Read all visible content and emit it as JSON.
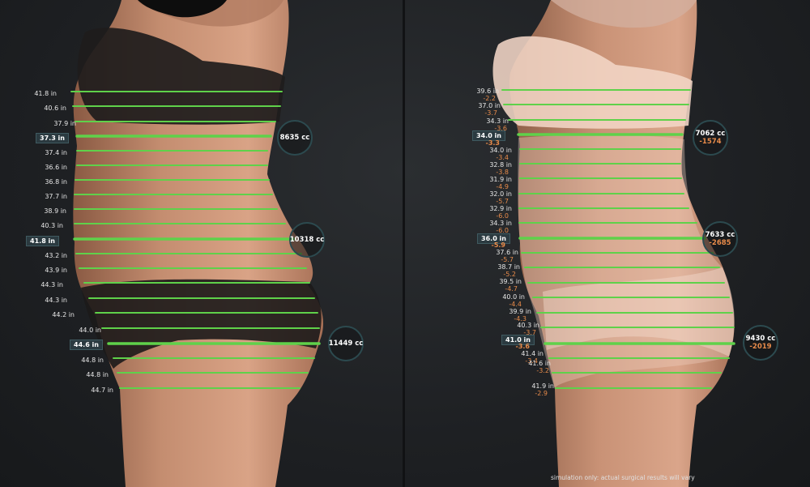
{
  "disclaimer": "simulation only: actual surgical results will vary",
  "colors": {
    "line": "#5fd14a",
    "delta": "#e88b4a",
    "ring": "#2c4a4f"
  },
  "before": {
    "measurements": [
      "41.8 in",
      "40.6 in",
      "37.9 in",
      "37.3 in",
      "37.4 in",
      "36.6 in",
      "36.8 in",
      "37.7 in",
      "38.9 in",
      "40.3 in",
      "41.8 in",
      "43.2 in",
      "43.9 in",
      "44.3 in",
      "44.3 in",
      "44.2 in",
      "44.0 in",
      "44.6 in",
      "44.8 in",
      "44.8 in",
      "44.7 in"
    ],
    "key_indices": [
      3,
      10,
      17
    ],
    "volumes": [
      "8635 cc",
      "10318 cc",
      "11449 cc"
    ]
  },
  "after": {
    "measurements": [
      {
        "value": "39.6 in",
        "delta": "-2.2"
      },
      {
        "value": "37.0 in",
        "delta": "-3.7"
      },
      {
        "value": "34.3 in",
        "delta": "-3.6"
      },
      {
        "value": "34.0 in",
        "delta": "-3.3"
      },
      {
        "value": "34.0 in",
        "delta": "-3.4"
      },
      {
        "value": "32.8 in",
        "delta": "-3.8"
      },
      {
        "value": "31.9 in",
        "delta": "-4.9"
      },
      {
        "value": "32.0 in",
        "delta": "-5.7"
      },
      {
        "value": "32.9 in",
        "delta": "-6.0"
      },
      {
        "value": "34.3 in",
        "delta": "-6.0"
      },
      {
        "value": "36.0 in",
        "delta": "-5.9"
      },
      {
        "value": "37.6 in",
        "delta": "-5.7"
      },
      {
        "value": "38.7 in",
        "delta": "-5.2"
      },
      {
        "value": "39.5 in",
        "delta": "-4.7"
      },
      {
        "value": "40.0 in",
        "delta": "-4.4"
      },
      {
        "value": "39.9 in",
        "delta": "-4.3"
      },
      {
        "value": "40.3 in",
        "delta": "-3.7"
      },
      {
        "value": "41.0 in",
        "delta": "-3.6"
      },
      {
        "value": "41.4 in",
        "delta": "-3.4"
      },
      {
        "value": "41.6 in",
        "delta": "-3.2"
      },
      {
        "value": "41.9 in",
        "delta": "-2.9"
      }
    ],
    "key_indices": [
      3,
      10,
      17
    ],
    "volumes": [
      {
        "value": "7062 cc",
        "delta": "-1574"
      },
      {
        "value": "7633 cc",
        "delta": "-2685"
      },
      {
        "value": "9430 cc",
        "delta": "-2019"
      }
    ]
  }
}
